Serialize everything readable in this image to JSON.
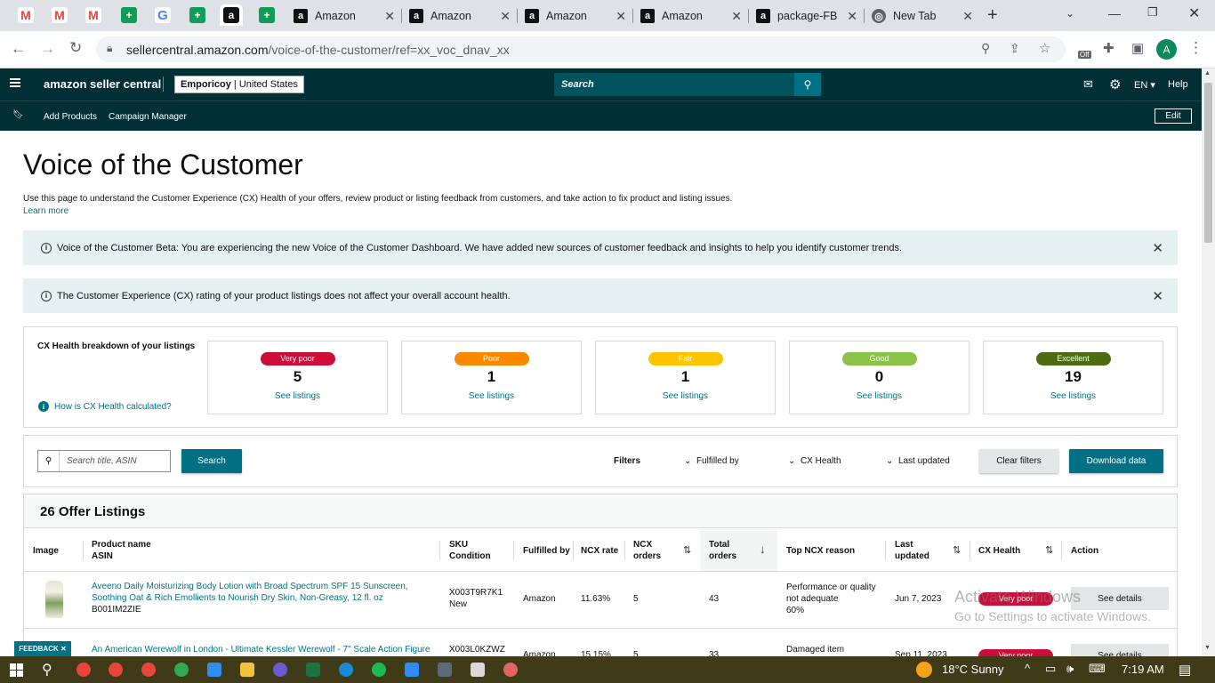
{
  "browser": {
    "tabs": [
      {
        "title": "Amazon"
      },
      {
        "title": "Amazon"
      },
      {
        "title": "Amazon"
      },
      {
        "title": "Amazon"
      },
      {
        "title": "package-FB"
      },
      {
        "title": "New Tab"
      }
    ],
    "url_host": "sellercentral.amazon.com",
    "url_path": "/voice-of-the-customer/ref=xx_voc_dnav_xx",
    "profile_initial": "A",
    "ext_badge": "Off"
  },
  "header": {
    "logo": "amazon seller central",
    "store": "Emporicoy",
    "region": "United States",
    "search_placeholder": "Search",
    "lang": "EN",
    "help": "Help"
  },
  "subnav": {
    "items": [
      "Add Products",
      "Campaign Manager"
    ],
    "edit": "Edit"
  },
  "page": {
    "title": "Voice of the Customer",
    "description": "Use this page to understand the Customer Experience (CX) Health of your offers, review product or listing feedback from customers, and take action to fix product and listing issues.",
    "learn_more": "Learn more",
    "banner1": "Voice of the Customer Beta: You are experiencing the new Voice of the Customer Dashboard. We have added new sources of customer feedback and insights to help you identify customer trends.",
    "banner2": "The Customer Experience (CX) rating of your product listings does not affect your overall account health."
  },
  "cx": {
    "label": "CX Health breakdown of your listings",
    "how": "How is CX Health calculated?",
    "cards": [
      {
        "label": "Very poor",
        "count": "5",
        "see": "See listings",
        "color": "#cc0c39"
      },
      {
        "label": "Poor",
        "count": "1",
        "see": "See listings",
        "color": "#fa8900"
      },
      {
        "label": "Fair",
        "count": "1",
        "see": "See listings",
        "color": "#ffc400"
      },
      {
        "label": "Good",
        "count": "0",
        "see": "See listings",
        "color": "#8bc34a"
      },
      {
        "label": "Excellent",
        "count": "19",
        "see": "See listings",
        "color": "#4b6c12"
      }
    ]
  },
  "filters": {
    "search_placeholder": "Search title, ASIN",
    "search_btn": "Search",
    "label": "Filters",
    "fulfilled_by": "Fulfilled by",
    "cx_health": "CX Health",
    "last_updated": "Last updated",
    "clear": "Clear filters",
    "download": "Download data"
  },
  "listings": {
    "title": "26 Offer Listings",
    "columns": {
      "image": "Image",
      "product": "Product name",
      "asin": "ASIN",
      "sku": "SKU",
      "condition": "Condition",
      "fulfilled": "Fulfilled by",
      "ncx_rate": "NCX rate",
      "ncx_orders_1": "NCX",
      "ncx_orders_2": "orders",
      "total_1": "Total",
      "total_2": "orders",
      "reason": "Top NCX reason",
      "last_1": "Last",
      "last_2": "updated",
      "cx": "CX Health",
      "action": "Action"
    },
    "rows": [
      {
        "name_1": "Aveeno Daily Moisturizing Body Lotion with Broad Spectrum SPF 15 Sunscreen,",
        "name_2": "Soothing Oat & Rich Emollients to Nourish Dry Skin, Non-Greasy, 12 fl. oz",
        "asin": "B001IM2ZIE",
        "sku": "X003T9R7K1",
        "condition": "New",
        "fulfilled": "Amazon",
        "ncx_rate": "11.63%",
        "ncx_orders": "5",
        "total": "43",
        "reason_1": "Performance or quality",
        "reason_2": "not adequate",
        "reason_3": "60%",
        "updated": "Jun 7, 2023",
        "cx": "Very poor",
        "action": "See details"
      },
      {
        "name_1": "An American Werewolf in London - Ultimate Kessler Werewolf - 7\" Scale Action Figure",
        "sku": "X003L0KZWZ",
        "fulfilled": "Amazon",
        "ncx_rate": "15.15%",
        "ncx_orders": "5",
        "total": "33",
        "reason_1": "Damaged item",
        "updated": "Sep 11, 2023",
        "cx": "Very poor",
        "action": "See details"
      }
    ]
  },
  "watermark": {
    "line1": "Activate Windows",
    "line2": "Go to Settings to activate Windows."
  },
  "feedback": "FEEDBACK",
  "taskbar": {
    "weather": "18°C  Sunny",
    "time": "7:19 AM"
  }
}
